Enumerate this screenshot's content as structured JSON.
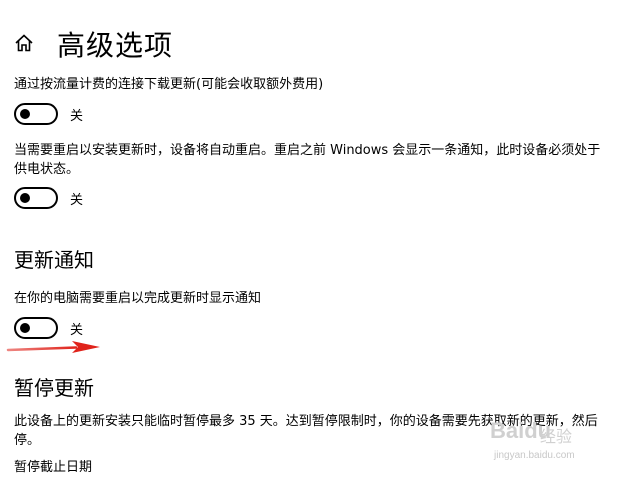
{
  "header": {
    "home_icon": "home-icon",
    "title": "高级选项"
  },
  "settings": {
    "metered": {
      "description": "通过按流量计费的连接下载更新(可能会收取额外费用)",
      "state_label": "关",
      "is_on": false
    },
    "restart": {
      "description_line1": "当需要重启以安装更新时，设备将自动重启。重启之前 Windows 会显示一条通知，此时设备必须处于",
      "description_line2": "供电状态。",
      "state_label": "关",
      "is_on": false
    }
  },
  "notifications": {
    "title": "更新通知",
    "restart_notice": {
      "description": "在你的电脑需要重启以完成更新时显示通知",
      "state_label": "关",
      "is_on": false
    }
  },
  "pause": {
    "title": "暂停更新",
    "description_line1": "此设备上的更新安装只能临时暂停最多 35 天。达到暂停限制时，你的设备需要先获取新的更新，然后",
    "description_line2": "停。",
    "date_label": "暂停截止日期"
  },
  "annotation": {
    "arrow_color": "#e0231b"
  },
  "watermark": {
    "brand": "Baidu",
    "sub": "经验",
    "url": "jingyan.baidu.com"
  }
}
